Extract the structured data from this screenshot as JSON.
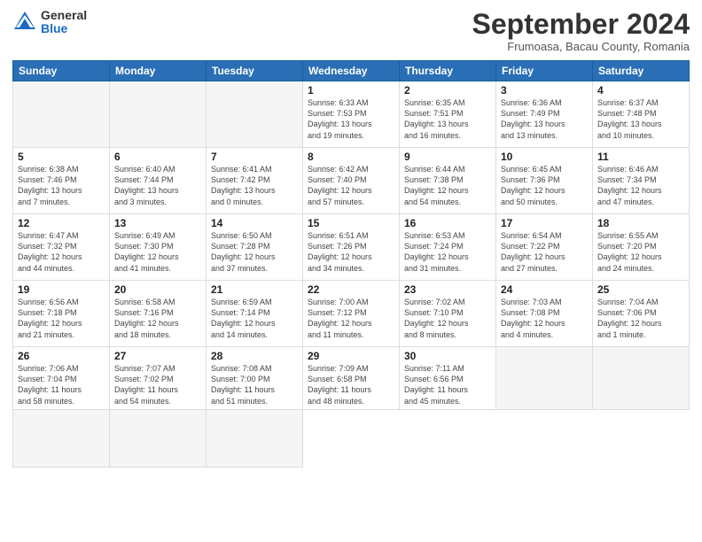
{
  "logo": {
    "general": "General",
    "blue": "Blue"
  },
  "header": {
    "month": "September 2024",
    "location": "Frumoasa, Bacau County, Romania"
  },
  "weekdays": [
    "Sunday",
    "Monday",
    "Tuesday",
    "Wednesday",
    "Thursday",
    "Friday",
    "Saturday"
  ],
  "days": [
    {
      "num": "",
      "info": ""
    },
    {
      "num": "",
      "info": ""
    },
    {
      "num": "",
      "info": ""
    },
    {
      "num": "1",
      "info": "Sunrise: 6:33 AM\nSunset: 7:53 PM\nDaylight: 13 hours\nand 19 minutes."
    },
    {
      "num": "2",
      "info": "Sunrise: 6:35 AM\nSunset: 7:51 PM\nDaylight: 13 hours\nand 16 minutes."
    },
    {
      "num": "3",
      "info": "Sunrise: 6:36 AM\nSunset: 7:49 PM\nDaylight: 13 hours\nand 13 minutes."
    },
    {
      "num": "4",
      "info": "Sunrise: 6:37 AM\nSunset: 7:48 PM\nDaylight: 13 hours\nand 10 minutes."
    },
    {
      "num": "5",
      "info": "Sunrise: 6:38 AM\nSunset: 7:46 PM\nDaylight: 13 hours\nand 7 minutes."
    },
    {
      "num": "6",
      "info": "Sunrise: 6:40 AM\nSunset: 7:44 PM\nDaylight: 13 hours\nand 3 minutes."
    },
    {
      "num": "7",
      "info": "Sunrise: 6:41 AM\nSunset: 7:42 PM\nDaylight: 13 hours\nand 0 minutes."
    },
    {
      "num": "8",
      "info": "Sunrise: 6:42 AM\nSunset: 7:40 PM\nDaylight: 12 hours\nand 57 minutes."
    },
    {
      "num": "9",
      "info": "Sunrise: 6:44 AM\nSunset: 7:38 PM\nDaylight: 12 hours\nand 54 minutes."
    },
    {
      "num": "10",
      "info": "Sunrise: 6:45 AM\nSunset: 7:36 PM\nDaylight: 12 hours\nand 50 minutes."
    },
    {
      "num": "11",
      "info": "Sunrise: 6:46 AM\nSunset: 7:34 PM\nDaylight: 12 hours\nand 47 minutes."
    },
    {
      "num": "12",
      "info": "Sunrise: 6:47 AM\nSunset: 7:32 PM\nDaylight: 12 hours\nand 44 minutes."
    },
    {
      "num": "13",
      "info": "Sunrise: 6:49 AM\nSunset: 7:30 PM\nDaylight: 12 hours\nand 41 minutes."
    },
    {
      "num": "14",
      "info": "Sunrise: 6:50 AM\nSunset: 7:28 PM\nDaylight: 12 hours\nand 37 minutes."
    },
    {
      "num": "15",
      "info": "Sunrise: 6:51 AM\nSunset: 7:26 PM\nDaylight: 12 hours\nand 34 minutes."
    },
    {
      "num": "16",
      "info": "Sunrise: 6:53 AM\nSunset: 7:24 PM\nDaylight: 12 hours\nand 31 minutes."
    },
    {
      "num": "17",
      "info": "Sunrise: 6:54 AM\nSunset: 7:22 PM\nDaylight: 12 hours\nand 27 minutes."
    },
    {
      "num": "18",
      "info": "Sunrise: 6:55 AM\nSunset: 7:20 PM\nDaylight: 12 hours\nand 24 minutes."
    },
    {
      "num": "19",
      "info": "Sunrise: 6:56 AM\nSunset: 7:18 PM\nDaylight: 12 hours\nand 21 minutes."
    },
    {
      "num": "20",
      "info": "Sunrise: 6:58 AM\nSunset: 7:16 PM\nDaylight: 12 hours\nand 18 minutes."
    },
    {
      "num": "21",
      "info": "Sunrise: 6:59 AM\nSunset: 7:14 PM\nDaylight: 12 hours\nand 14 minutes."
    },
    {
      "num": "22",
      "info": "Sunrise: 7:00 AM\nSunset: 7:12 PM\nDaylight: 12 hours\nand 11 minutes."
    },
    {
      "num": "23",
      "info": "Sunrise: 7:02 AM\nSunset: 7:10 PM\nDaylight: 12 hours\nand 8 minutes."
    },
    {
      "num": "24",
      "info": "Sunrise: 7:03 AM\nSunset: 7:08 PM\nDaylight: 12 hours\nand 4 minutes."
    },
    {
      "num": "25",
      "info": "Sunrise: 7:04 AM\nSunset: 7:06 PM\nDaylight: 12 hours\nand 1 minute."
    },
    {
      "num": "26",
      "info": "Sunrise: 7:06 AM\nSunset: 7:04 PM\nDaylight: 11 hours\nand 58 minutes."
    },
    {
      "num": "27",
      "info": "Sunrise: 7:07 AM\nSunset: 7:02 PM\nDaylight: 11 hours\nand 54 minutes."
    },
    {
      "num": "28",
      "info": "Sunrise: 7:08 AM\nSunset: 7:00 PM\nDaylight: 11 hours\nand 51 minutes."
    },
    {
      "num": "29",
      "info": "Sunrise: 7:09 AM\nSunset: 6:58 PM\nDaylight: 11 hours\nand 48 minutes."
    },
    {
      "num": "30",
      "info": "Sunrise: 7:11 AM\nSunset: 6:56 PM\nDaylight: 11 hours\nand 45 minutes."
    },
    {
      "num": "",
      "info": ""
    },
    {
      "num": "",
      "info": ""
    },
    {
      "num": "",
      "info": ""
    },
    {
      "num": "",
      "info": ""
    },
    {
      "num": "",
      "info": ""
    }
  ]
}
